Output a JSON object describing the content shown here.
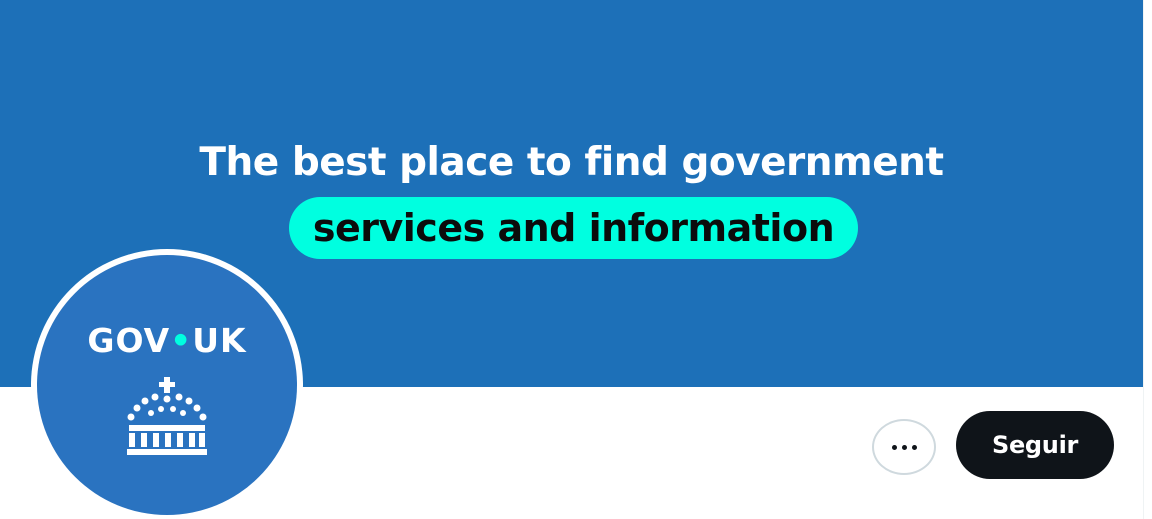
{
  "banner": {
    "headline": "The best place to find government",
    "highlight": "services and information",
    "colors": {
      "background": "#1d70b8",
      "highlight": "#00ffe0"
    }
  },
  "profile": {
    "avatar": {
      "wordmark_left": "GOV",
      "wordmark_separator": "•",
      "wordmark_right": "UK",
      "icon": "crown-icon"
    }
  },
  "actions": {
    "more_icon": "more-horizontal-icon",
    "follow_label": "Seguir"
  }
}
